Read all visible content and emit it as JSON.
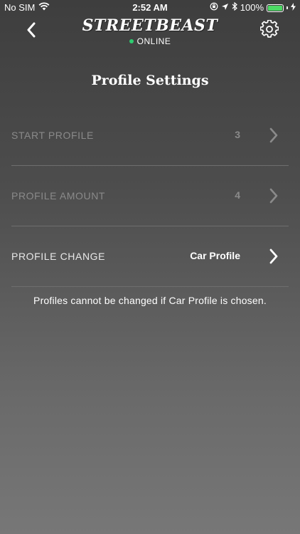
{
  "status_bar": {
    "carrier": "No SIM",
    "time": "2:52 AM",
    "battery_percent": "100%",
    "battery_level": 1.0,
    "battery_color": "#4cd964"
  },
  "nav": {
    "back_icon": "chevron-left-icon",
    "logo": "STREETBEAST",
    "connection_status": "ONLINE",
    "connection_color": "#2ecc71",
    "settings_icon": "gear-icon"
  },
  "page": {
    "title": "Profile Settings"
  },
  "settings": [
    {
      "label": "START PROFILE",
      "value": "3",
      "enabled": false
    },
    {
      "label": "PROFILE AMOUNT",
      "value": "4",
      "enabled": false
    },
    {
      "label": "PROFILE CHANGE",
      "value": "Car Profile",
      "enabled": true
    }
  ],
  "note": "Profiles cannot be changed if Car Profile is chosen.",
  "colors": {
    "disabled_text": "#8a8a8a",
    "enabled_text": "#ffffff"
  }
}
